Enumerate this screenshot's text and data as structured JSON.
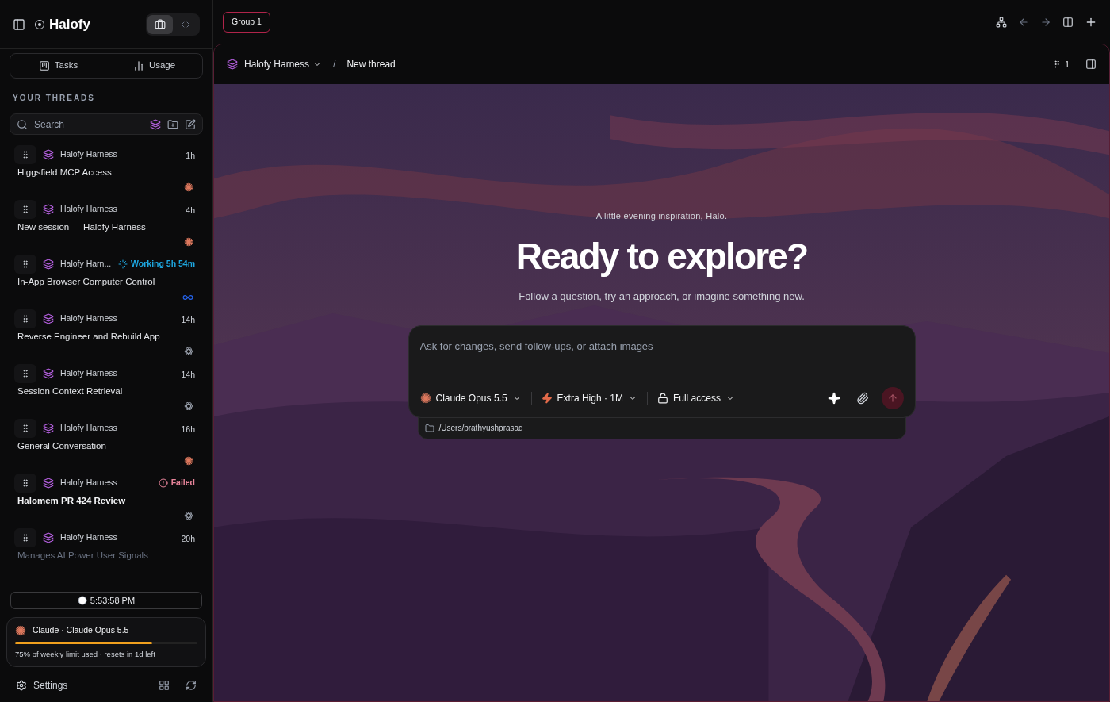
{
  "app": {
    "name": "Halofy",
    "modes": [
      {
        "kind": "work",
        "selected": true
      },
      {
        "kind": "code",
        "selected": false
      }
    ]
  },
  "sidebar": {
    "nav": [
      {
        "kind": "tasks",
        "label": "Tasks"
      },
      {
        "kind": "usage",
        "label": "Usage"
      }
    ],
    "section_title": "YOUR THREADS",
    "search": {
      "placeholder": "Search"
    },
    "threads": [
      {
        "project": "Halofy Harness",
        "status": {
          "kind": "time",
          "text": "1h"
        },
        "title": "Higgsfield MCP Access",
        "model": {
          "kind": "claude"
        },
        "bold": false
      },
      {
        "project": "Halofy Harness",
        "status": {
          "kind": "time",
          "text": "4h"
        },
        "title": "New session — Halofy Harness",
        "model": {
          "kind": "claude"
        },
        "bold": false
      },
      {
        "project": "Halofy Harn...",
        "status": {
          "kind": "working",
          "text": "Working 5h 54m"
        },
        "title": "In-App Browser Computer Control",
        "model": {
          "kind": "meta"
        },
        "bold": false
      },
      {
        "project": "Halofy Harness",
        "status": {
          "kind": "time",
          "text": "14h"
        },
        "title": "Reverse Engineer and Rebuild App",
        "model": {
          "kind": "openai"
        },
        "bold": false
      },
      {
        "project": "Halofy Harness",
        "status": {
          "kind": "time",
          "text": "14h"
        },
        "title": "Session Context Retrieval",
        "model": {
          "kind": "openai"
        },
        "bold": false
      },
      {
        "project": "Halofy Harness",
        "status": {
          "kind": "time",
          "text": "16h"
        },
        "title": "General Conversation",
        "model": {
          "kind": "claude"
        },
        "bold": false
      },
      {
        "project": "Halofy Harness",
        "status": {
          "kind": "failed",
          "text": "Failed"
        },
        "title": "Halomem PR 424 Review",
        "model": {
          "kind": "openai"
        },
        "bold": true
      },
      {
        "project": "Halofy Harness",
        "status": {
          "kind": "time",
          "text": "20h"
        },
        "title": "Manages AI Power User Signals",
        "bold": false,
        "faded": true
      }
    ],
    "clock": "5:53:58 PM",
    "usage": {
      "title": "Claude · Claude Opus 5.5",
      "level": 0.75,
      "note": "75% of weekly limit used · resets in 1d left"
    },
    "settings": "Settings"
  },
  "topbar": {
    "group": "Group 1"
  },
  "thread_header": {
    "project": "Halofy Harness",
    "separator": "/",
    "title": "New thread",
    "count": "1"
  },
  "hero": {
    "eyebrow": "A little evening inspiration, Halo.",
    "heading": "Ready to explore?",
    "subtitle": "Follow a question, try an approach, or imagine something new."
  },
  "composer": {
    "placeholder": "Ask for changes, send follow-ups, or attach images",
    "model": "Claude Opus 5.5",
    "effort": "Extra High · 1M",
    "access": "Full access",
    "path": "/Users/prathyushprasad"
  }
}
